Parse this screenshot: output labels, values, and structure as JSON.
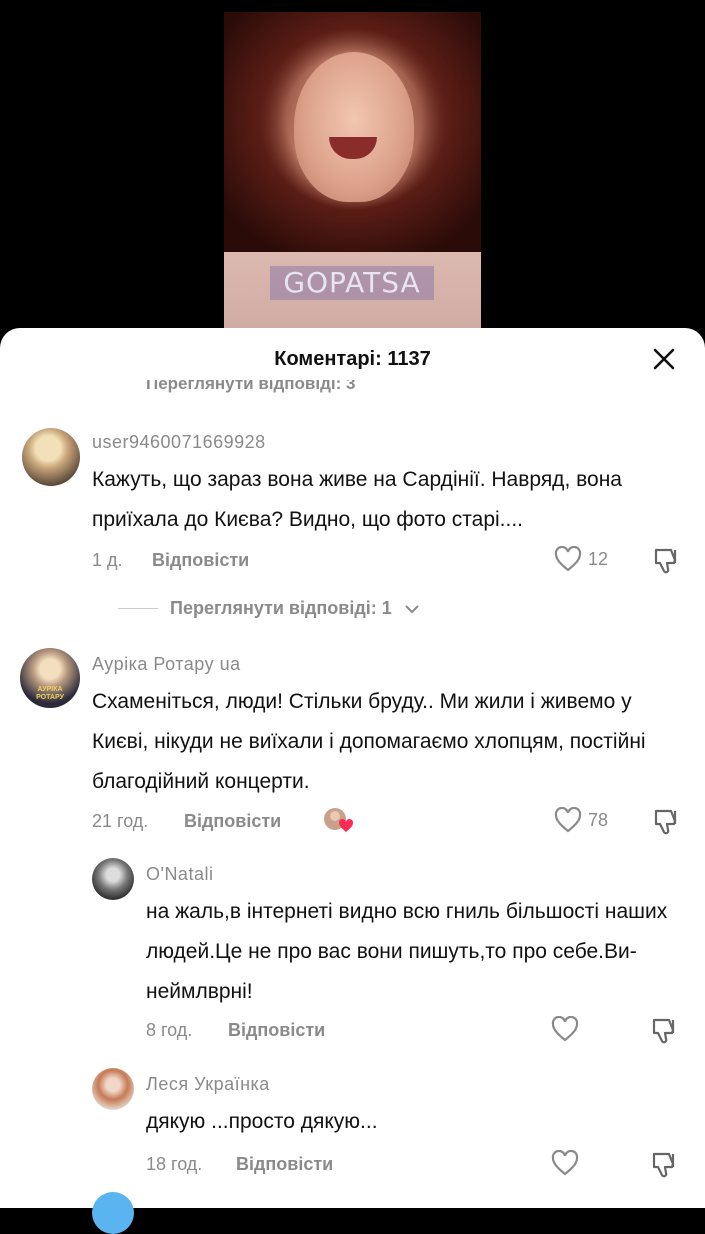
{
  "video": {
    "watermark": "GOPATSA"
  },
  "sheet": {
    "title": "Коментарі: 1137",
    "partial_view_replies": "Переглянути відповіді: 3"
  },
  "comments": [
    {
      "username": "user9460071669928",
      "text": "Кажуть, що зараз вона живе на Сардінії. Навряд, вона приїхала до Києва? Видно, що фото старі....",
      "time": "1 д.",
      "reply_label": "Відповісти",
      "likes": "12",
      "view_replies": "Переглянути відповіді: 1"
    },
    {
      "username": "Ауріка Ротару ua",
      "avatar_text": "АУРІКА РОТАРУ",
      "text": "Схаменіться, люди! Стільки бруду.. Ми жили і живемо у Києві, нікуди не виїхали і допомагаємо хлопцям, постійні благодійний концерти.",
      "time": "21 год.",
      "reply_label": "Відповісти",
      "likes": "78"
    },
    {
      "username": "O'Natali",
      "text": "на жаль,в інтернеті видно всю гниль більшості наших людей.Це не про вас вони пишуть,то про себе.Ви-неймлврні!",
      "time": "8 год.",
      "reply_label": "Відповісти"
    },
    {
      "username": "Леся Українка",
      "text": "дякую ...просто дякую...",
      "time": "18 год.",
      "reply_label": "Відповісти"
    }
  ],
  "colors": {
    "sheet_bg": "#ffffff",
    "muted": "#8a8a8a",
    "text": "#111111"
  },
  "icons": [
    "close-icon",
    "heart-icon",
    "dislike-icon",
    "chevron-down-icon",
    "creator-liked-icon"
  ]
}
